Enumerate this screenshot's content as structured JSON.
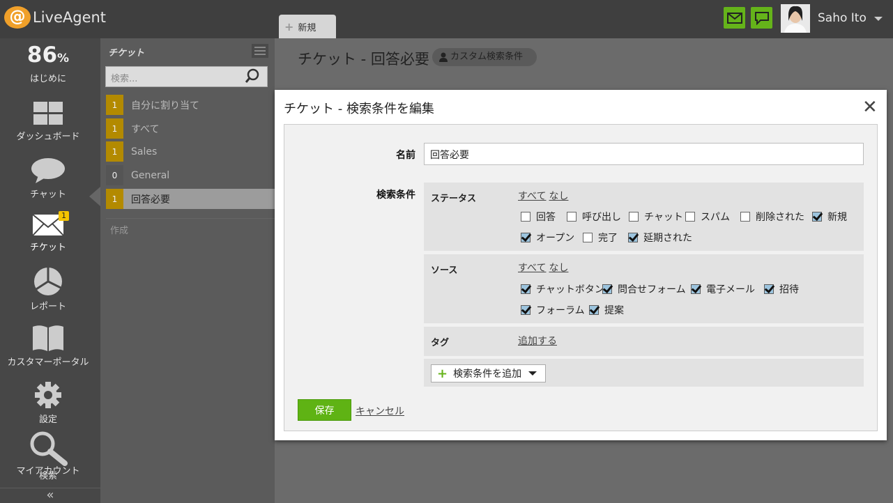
{
  "app": {
    "name": "LiveAgent",
    "at": "@"
  },
  "tabs": {
    "new_tab": "新規"
  },
  "user": {
    "name": "Saho Ito"
  },
  "nav": {
    "onboarding_percent": "86",
    "percent_sign": "%",
    "onboarding_label": "はじめに",
    "dashboard": "ダッシュボード",
    "chat": "チャット",
    "tickets": "チケット",
    "tickets_badge": "1",
    "reports": "レポート",
    "customer_portal": "カスタマーポータル",
    "settings": "設定",
    "search": "検索",
    "my_account": "マイアカウント",
    "collapse": "«"
  },
  "ticket_panel": {
    "title": "チケット",
    "search_placeholder": "検索...",
    "filters": [
      {
        "count": "1",
        "label": "自分に割り当て"
      },
      {
        "count": "1",
        "label": "すべて"
      },
      {
        "count": "1",
        "label": "Sales"
      },
      {
        "count": "0",
        "label": "General"
      },
      {
        "count": "1",
        "label": "回答必要"
      }
    ],
    "create": "作成"
  },
  "main": {
    "title": "チケット - 回答必要",
    "badge": "カスタム検索条件"
  },
  "dialog": {
    "title": "チケット - 検索条件を編集",
    "close": "✕",
    "name_label": "名前",
    "name_value": "回答必要",
    "criteria_label": "検索条件",
    "all": "すべて",
    "none": "なし",
    "status": {
      "title": "ステータス",
      "options": [
        {
          "label": "回答",
          "checked": false
        },
        {
          "label": "呼び出し",
          "checked": false
        },
        {
          "label": "チャット",
          "checked": false
        },
        {
          "label": "スパム",
          "checked": false
        },
        {
          "label": "削除された",
          "checked": false
        },
        {
          "label": "新規",
          "checked": true
        },
        {
          "label": "オープン",
          "checked": true
        },
        {
          "label": "完了",
          "checked": false
        },
        {
          "label": "延期された",
          "checked": true
        }
      ]
    },
    "source": {
      "title": "ソース",
      "options": [
        {
          "label": "チャットボタン",
          "checked": true
        },
        {
          "label": "問合せフォーム",
          "checked": true
        },
        {
          "label": "電子メール",
          "checked": true
        },
        {
          "label": "招待",
          "checked": true
        },
        {
          "label": "フォーラム",
          "checked": true
        },
        {
          "label": "提案",
          "checked": true
        }
      ]
    },
    "tags": {
      "title": "タグ",
      "add": "追加する"
    },
    "add_condition": "検索条件を追加",
    "save": "保存",
    "cancel": "キャンセル"
  }
}
